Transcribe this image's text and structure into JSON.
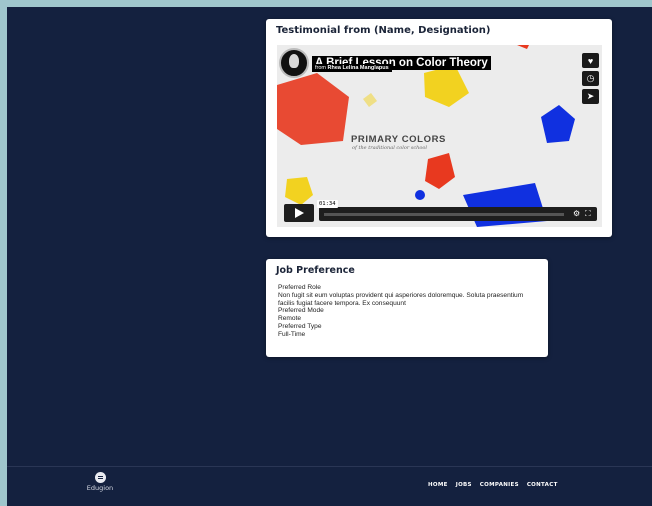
{
  "testimonial": {
    "title": "Testimonial from (Name, Designation)",
    "video": {
      "title": "A Brief Lesson on Color Theory",
      "byline_prefix": "from",
      "author": "Rhea Lelina Manglapus",
      "overlay_heading": "PRIMARY COLORS",
      "overlay_sub": "of the traditional color school",
      "timestamp": "01:34",
      "icons": {
        "like": "heart-icon",
        "watch_later": "clock-icon",
        "share": "paper-plane-icon",
        "play": "play-icon",
        "settings": "gear-icon",
        "fullscreen": "fullscreen-icon"
      }
    }
  },
  "job_preference": {
    "title": "Job Preference",
    "lines": [
      "Preferred Role",
      "Non fugit sit eum voluptas provident qui asperiores doloremque. Soluta praesentium facilis fugiat facere tempora. Ex consequunt",
      "Preferred Mode",
      "Remote",
      "Preferred Type",
      "Full-Time"
    ]
  },
  "footer": {
    "logo_text": "Edugion",
    "nav": [
      "HOME",
      "JOBS",
      "COMPANIES",
      "CONTACT"
    ]
  },
  "colors": {
    "page_bg": "#14213f",
    "outer_bg": "#9fc6cc",
    "card_bg": "#ffffff",
    "accent_red": "#e8391f",
    "accent_yellow": "#f2d220",
    "accent_blue": "#1030e0"
  }
}
